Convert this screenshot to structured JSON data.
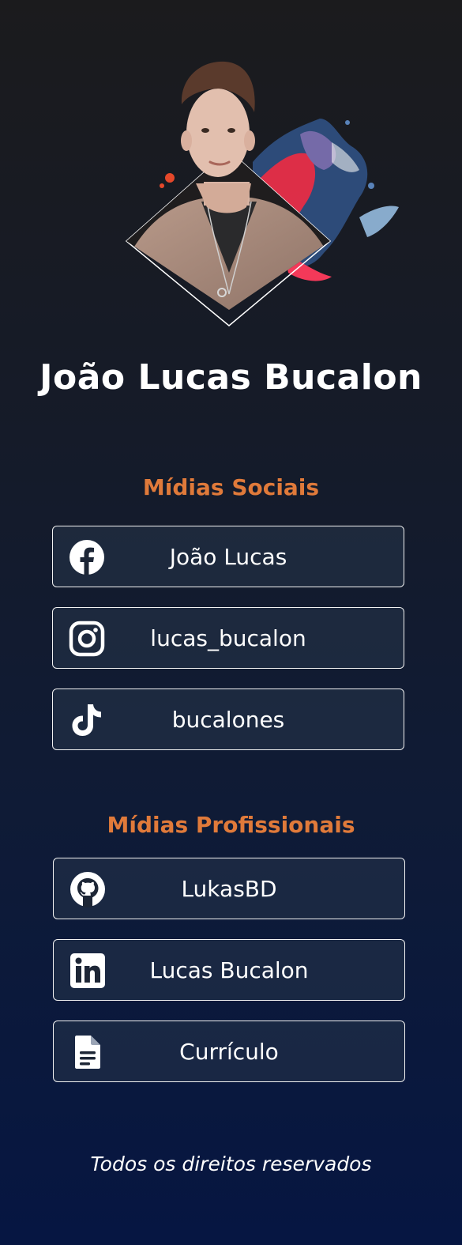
{
  "profile": {
    "name": "João Lucas Bucalon"
  },
  "sections": {
    "social_title": "Mídias Sociais",
    "professional_title": "Mídias Profissionais"
  },
  "social_links": [
    {
      "icon": "facebook-icon",
      "label": "João Lucas"
    },
    {
      "icon": "instagram-icon",
      "label": "lucas_bucalon"
    },
    {
      "icon": "tiktok-icon",
      "label": "bucalones"
    }
  ],
  "professional_links": [
    {
      "icon": "github-icon",
      "label": "LukasBD"
    },
    {
      "icon": "linkedin-icon",
      "label": "Lucas Bucalon"
    },
    {
      "icon": "document-icon",
      "label": "Currículo"
    }
  ],
  "footer": {
    "text": "Todos os direitos reservados"
  },
  "colors": {
    "accent": "#e07a3a",
    "background_top": "#1b1b1d",
    "background_bottom": "#061642",
    "card_border": "#f2f2f2"
  }
}
